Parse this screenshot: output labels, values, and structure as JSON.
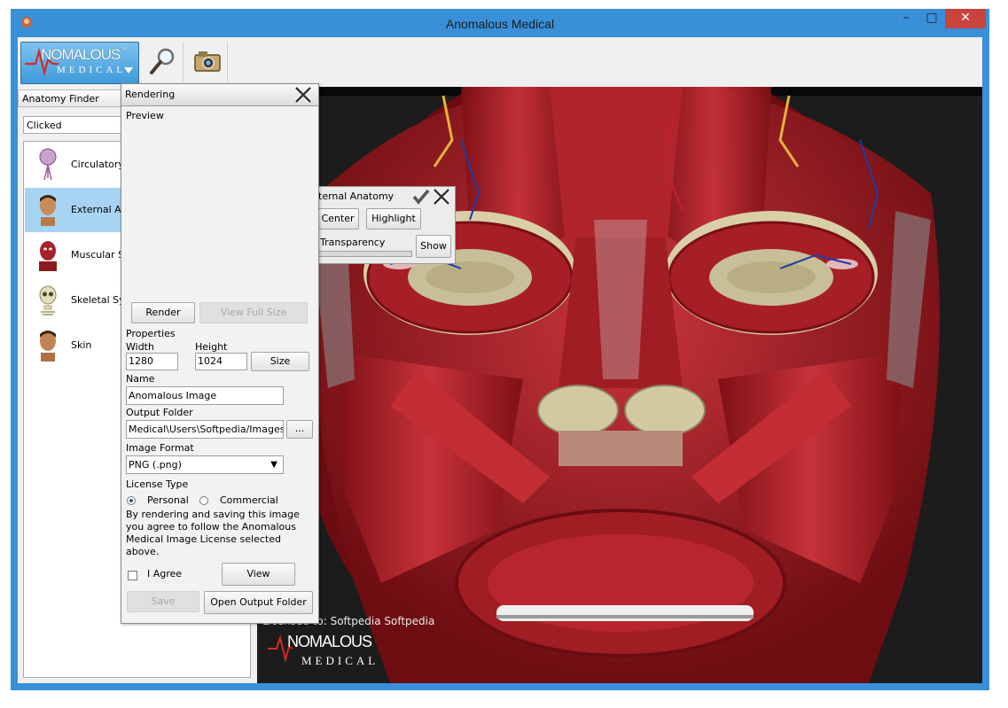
{
  "window": {
    "title": "Anomalous Medical",
    "minimize": "–",
    "maximize": "□",
    "close": "✕"
  },
  "logo": {
    "line1": "NOMALOUS",
    "line2": "MEDICAL",
    "trademark": "™"
  },
  "finder": {
    "header": "Anatomy Finder",
    "search_value": "Clicked",
    "items": [
      {
        "label": "Circulatory",
        "icon": "circulatory-icon"
      },
      {
        "label": "External A",
        "icon": "external-anatomy-icon",
        "selected": true
      },
      {
        "label": "Muscular S",
        "icon": "muscular-icon"
      },
      {
        "label": "Skeletal Sy",
        "icon": "skeletal-icon"
      },
      {
        "label": "Skin",
        "icon": "skin-icon"
      }
    ]
  },
  "render": {
    "title": "Rendering",
    "preview_label": "Preview",
    "render_button": "Render",
    "view_full_size_button": "View Full Size",
    "properties_label": "Properties",
    "width_label": "Width",
    "width_value": "1280",
    "height_label": "Height",
    "height_value": "1024",
    "size_button": "Size",
    "name_label": "Name",
    "name_value": "Anomalous Image",
    "output_folder_label": "Output Folder",
    "output_folder_value": "Medical\\Users\\Softpedia/Images",
    "browse_button": "...",
    "image_format_label": "Image Format",
    "image_format_value": "PNG (.png)",
    "license_type_label": "License Type",
    "license_personal": "Personal",
    "license_commercial": "Commercial",
    "license_selected": "Personal",
    "license_text": "By rendering and saving this image you agree to follow the Anomalous Medical Image License selected above.",
    "agree_label": "I Agree",
    "view_button": "View",
    "save_button": "Save",
    "open_output_button": "Open Output Folder"
  },
  "popup": {
    "title": "ternal Anatomy",
    "center_button": "Center",
    "highlight_button": "Highlight",
    "transparency_label": "Transparency",
    "show_button": "Show"
  },
  "viewport": {
    "licensed_text": "Licensed to: Softpedia Softpedia",
    "watermark_line1": "NOMALOUS",
    "watermark_line2": "MEDICAL"
  },
  "colors": {
    "titlebar": "#3a8fd9",
    "close": "#c7433c",
    "muscle": "#b3242a",
    "bone": "#d8cfa6"
  }
}
